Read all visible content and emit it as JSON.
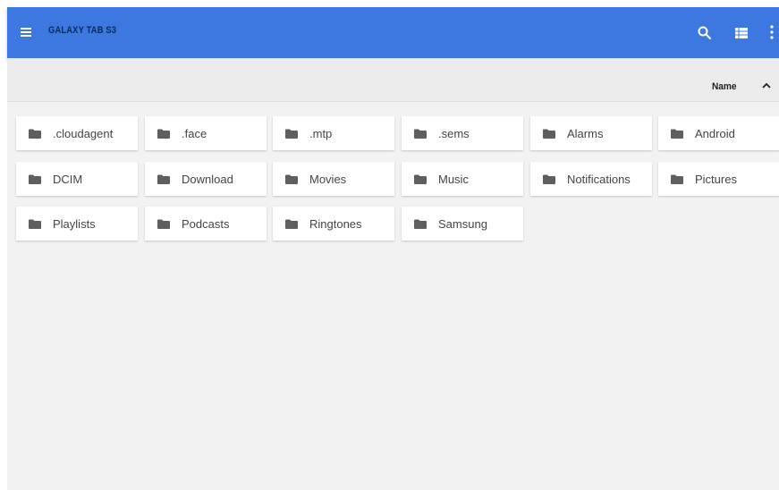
{
  "appbar": {
    "title": "GALAXY TAB S3",
    "menu_icon": "hamburger-menu-icon",
    "search_icon": "search-icon",
    "view_icon": "list-view-icon",
    "more_icon": "more-vert-icon",
    "color": "#3c78e0"
  },
  "sortbar": {
    "label": "Name",
    "direction_icon": "chevron-up-icon"
  },
  "folders": [
    {
      "name": ".cloudagent"
    },
    {
      "name": ".face"
    },
    {
      "name": ".mtp"
    },
    {
      "name": ".sems"
    },
    {
      "name": "Alarms"
    },
    {
      "name": "Android"
    },
    {
      "name": "DCIM"
    },
    {
      "name": "Download"
    },
    {
      "name": "Movies"
    },
    {
      "name": "Music"
    },
    {
      "name": "Notifications"
    },
    {
      "name": "Pictures"
    },
    {
      "name": "Playlists"
    },
    {
      "name": "Podcasts"
    },
    {
      "name": "Ringtones"
    },
    {
      "name": "Samsung"
    }
  ]
}
